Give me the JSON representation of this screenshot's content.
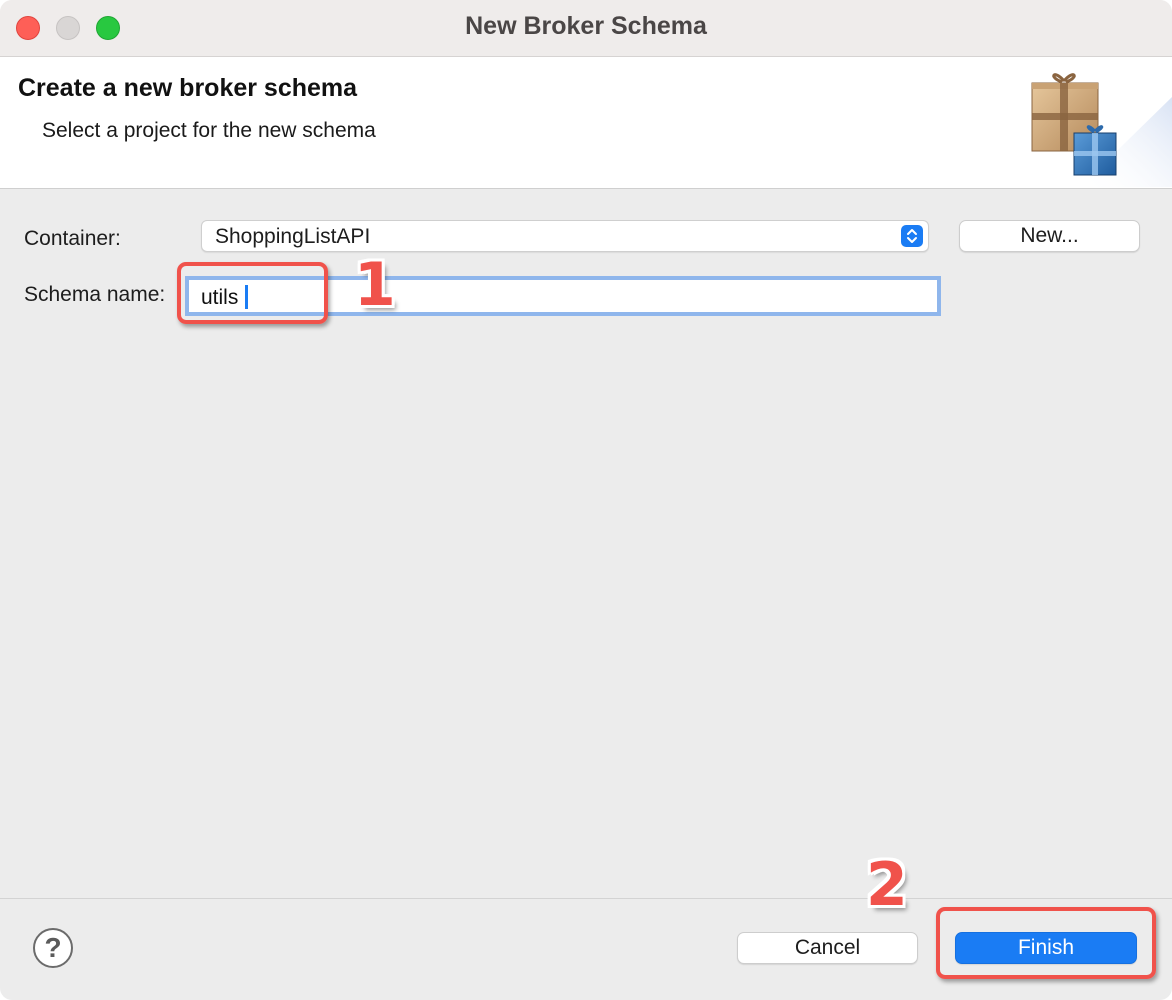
{
  "window": {
    "title": "New Broker Schema"
  },
  "header": {
    "title": "Create a new broker schema",
    "subtitle": "Select a project for the new schema",
    "art_icon": "wizard-gift-boxes-icon"
  },
  "form": {
    "container_label": "Container:",
    "container_value": "ShoppingListAPI",
    "new_button_label": "New...",
    "schema_name_label": "Schema name:",
    "schema_name_value": "utils"
  },
  "annotations": {
    "step1": "1",
    "step2": "2",
    "highlight_color": "#f0524b"
  },
  "footer": {
    "help_symbol": "?",
    "cancel_label": "Cancel",
    "finish_label": "Finish"
  },
  "colors": {
    "accent": "#1a7cf4",
    "focus_ring": "#8fb6ec"
  }
}
